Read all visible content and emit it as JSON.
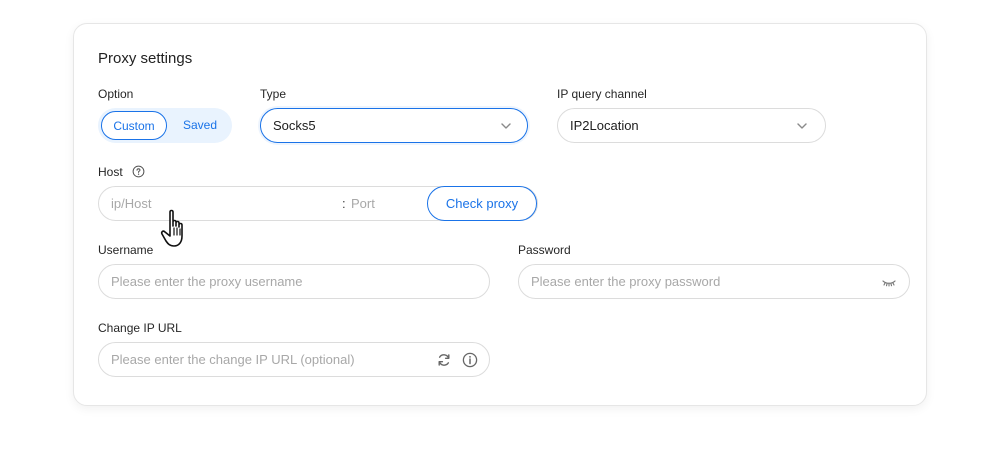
{
  "card": {
    "title": "Proxy settings"
  },
  "option": {
    "label": "Option",
    "items": [
      "Custom",
      "Saved"
    ],
    "selected": "Custom"
  },
  "type": {
    "label": "Type",
    "value": "Socks5"
  },
  "ip_query": {
    "label": "IP query channel",
    "value": "IP2Location"
  },
  "host": {
    "label": "Host",
    "host_placeholder": "ip/Host",
    "port_separator": ":",
    "port_placeholder": "Port",
    "check_button": "Check proxy"
  },
  "username": {
    "label": "Username",
    "placeholder": "Please enter the proxy username"
  },
  "password": {
    "label": "Password",
    "placeholder": "Please enter the proxy password"
  },
  "change_ip": {
    "label": "Change IP URL",
    "placeholder": "Please enter the change IP URL (optional)"
  },
  "colors": {
    "accent": "#1a73e8",
    "segment_bg": "#e9f3fe",
    "border": "#dcdcdc",
    "placeholder": "#a8a8a8"
  },
  "icons": [
    "help-icon",
    "chevron-down-icon",
    "eye-closed-icon",
    "refresh-icon",
    "info-icon",
    "hand-cursor-icon"
  ]
}
